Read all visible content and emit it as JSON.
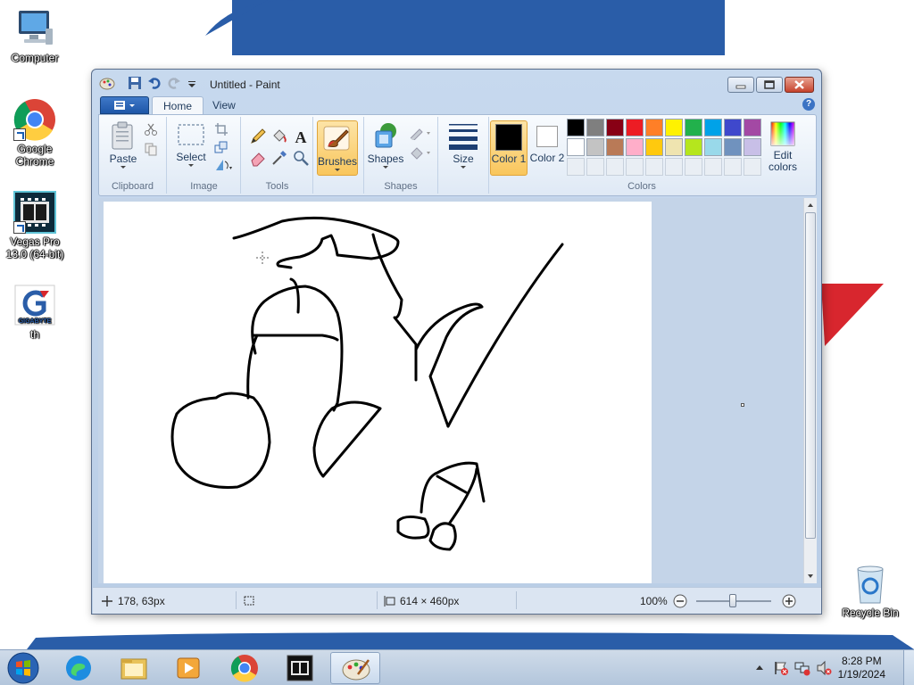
{
  "desktop": {
    "icons": [
      {
        "label": "Computer"
      },
      {
        "label": "Google Chrome"
      },
      {
        "label": "Vegas Pro 13.0 (64-bit)"
      },
      {
        "label": "th"
      },
      {
        "label": "Recycle Bin"
      }
    ],
    "wallpaper_colors": {
      "blue": "#2a5da8",
      "red": "#d8262e"
    }
  },
  "window": {
    "title": "Untitled - Paint",
    "tabs": [
      {
        "label": "Home",
        "active": true
      },
      {
        "label": "View",
        "active": false
      }
    ],
    "ribbon": {
      "clipboard": {
        "group_label": "Clipboard",
        "paste_label": "Paste"
      },
      "image": {
        "group_label": "Image",
        "select_label": "Select"
      },
      "tools": {
        "group_label": "Tools"
      },
      "brushes": {
        "label": "Brushes",
        "selected": true
      },
      "shapes": {
        "group_label": "Shapes",
        "shapes_label": "Shapes"
      },
      "size": {
        "label": "Size"
      },
      "colors": {
        "group_label": "Colors",
        "color1_label": "Color 1",
        "color2_label": "Color 2",
        "color1_value": "#000000",
        "color2_value": "#ffffff",
        "edit_colors_label": "Edit colors",
        "palette_row1": [
          "#000000",
          "#7f7f7f",
          "#880015",
          "#ed1c24",
          "#ff7f27",
          "#fff200",
          "#22b14c",
          "#00a2e8",
          "#3f48cc",
          "#a349a4"
        ],
        "palette_row2": [
          "#ffffff",
          "#c3c3c3",
          "#b97a57",
          "#ffaec9",
          "#ffc90e",
          "#efe4b0",
          "#b5e61d",
          "#99d9ea",
          "#7092be",
          "#c8bfe7"
        ]
      }
    },
    "status": {
      "cursor_pos": "178, 63px",
      "canvas_size": "614 × 460px",
      "zoom": "100%"
    }
  },
  "taskbar": {
    "time": "8:28 PM",
    "date": "1/19/2024"
  }
}
